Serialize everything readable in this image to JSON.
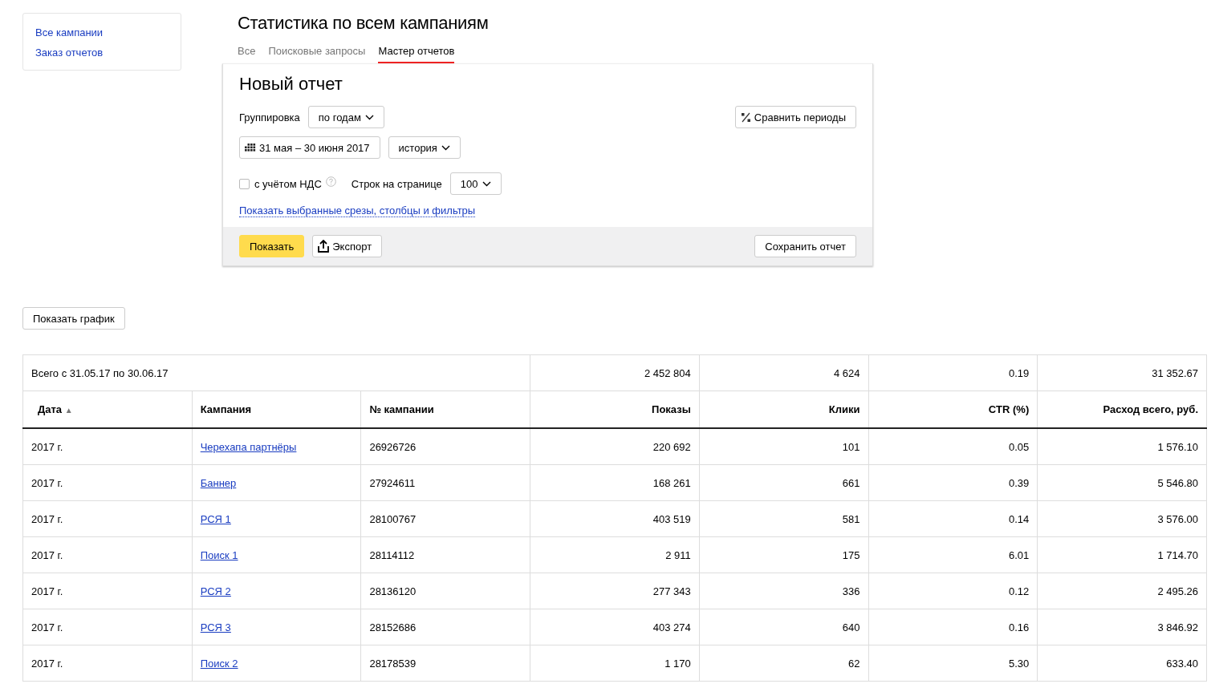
{
  "sidebar": {
    "links": [
      "Все кампании",
      "Заказ отчетов"
    ]
  },
  "page_title": "Статистика по всем кампаниям",
  "tabs": [
    {
      "label": "Все",
      "selected": false
    },
    {
      "label": "Поисковые запросы",
      "selected": false
    },
    {
      "label": "Мастер отчетов",
      "selected": true
    }
  ],
  "report": {
    "title": "Новый отчет",
    "grouping_label": "Группировка",
    "grouping_value": "по годам",
    "compare_button": "Сравнить периоды",
    "date_range": "31 мая – 30 июня 2017",
    "period_value": "история",
    "vat": {
      "label": "с учётом НДС",
      "checked": false
    },
    "rows_label": "Строк на странице",
    "rows_value": "100",
    "filters_link": "Показать выбранные срезы, столбцы и фильтры",
    "show_button": "Показать",
    "export_button": "Экспорт",
    "save_button": "Сохранить отчет"
  },
  "chart_button": "Показать график",
  "table": {
    "total": [
      "Всего с 31.05.17 по 30.06.17",
      "2 452 804",
      "4 624",
      "0.19",
      "31 352.67"
    ],
    "columns": [
      {
        "label": "Дата",
        "sort_mark": "▲"
      },
      {
        "label": "Кампания"
      },
      {
        "label": "№ кампании"
      },
      {
        "label": "Показы"
      },
      {
        "label": "Клики"
      },
      {
        "label": "CTR (%)"
      },
      {
        "label": "Расход всего, руб."
      }
    ],
    "rows": [
      [
        "2017 г.",
        "Черехапа партнёры",
        "26926726",
        "220 692",
        "101",
        "0.05",
        "1 576.10"
      ],
      [
        "2017 г.",
        "Баннер",
        "27924611",
        "168 261",
        "661",
        "0.39",
        "5 546.80"
      ],
      [
        "2017 г.",
        "РСЯ 1",
        "28100767",
        "403 519",
        "581",
        "0.14",
        "3 576.00"
      ],
      [
        "2017 г.",
        "Поиск 1",
        "28114112",
        "2 911",
        "175",
        "6.01",
        "1 714.70"
      ],
      [
        "2017 г.",
        "РСЯ 2",
        "28136120",
        "277 343",
        "336",
        "0.12",
        "2 495.26"
      ],
      [
        "2017 г.",
        "РСЯ 3",
        "28152686",
        "403 274",
        "640",
        "0.16",
        "3 846.92"
      ],
      [
        "2017 г.",
        "Поиск 2",
        "28178539",
        "1 170",
        "62",
        "5.30",
        "633.40"
      ]
    ]
  }
}
